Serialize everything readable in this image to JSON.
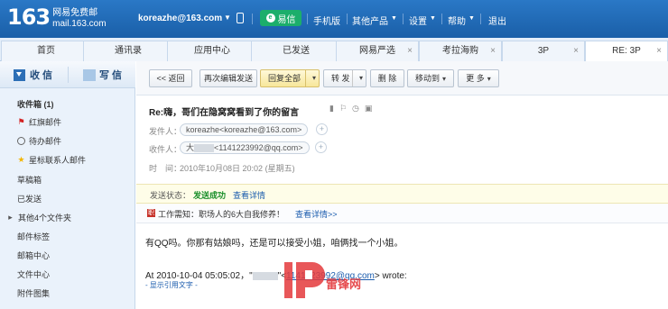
{
  "topbar": {
    "logo_num": "163",
    "logo_cn": "网易免费邮",
    "logo_domain": "mail.163.com",
    "user": "koreazhe@163.com",
    "yixin": "易信",
    "links": [
      "手机版",
      "其他产品",
      "设置",
      "帮助",
      "退出"
    ]
  },
  "tabs": [
    {
      "label": "首页",
      "closable": false
    },
    {
      "label": "通讯录",
      "closable": false
    },
    {
      "label": "应用中心",
      "closable": false
    },
    {
      "label": "已发送",
      "closable": false
    },
    {
      "label": "网易严选",
      "closable": true
    },
    {
      "label": "考拉海购",
      "closable": true
    },
    {
      "label": "3P",
      "closable": true
    },
    {
      "label": "RE: 3P",
      "closable": true
    }
  ],
  "sidebar": {
    "receive": "收 信",
    "compose": "写 信",
    "folders": [
      {
        "label": "收件箱 (1)",
        "icon": "none"
      },
      {
        "label": "红旗邮件",
        "icon": "flag-icon"
      },
      {
        "label": "待办邮件",
        "icon": "clock-icon"
      },
      {
        "label": "星标联系人邮件",
        "icon": "star-icon"
      },
      {
        "label": "草稿箱",
        "icon": "none"
      },
      {
        "label": "已发送",
        "icon": "none"
      },
      {
        "label": "其他4个文件夹",
        "icon": "caret-icon"
      },
      {
        "label": "邮件标签",
        "icon": "none"
      },
      {
        "label": "邮箱中心",
        "icon": "none"
      },
      {
        "label": "文件中心",
        "icon": "none"
      },
      {
        "label": "附件图集",
        "icon": "none"
      }
    ]
  },
  "toolbar": {
    "back": "<< 返回",
    "reedit": "再次编辑发送",
    "reply_all": "回复全部",
    "forward": "转 发",
    "delete": "删 除",
    "move": "移动到",
    "more": "更 多"
  },
  "mail": {
    "subject": "Re:嗨，哥们在隐窝窝看到了你的留言",
    "from_label": "发件人：",
    "from_value": "koreazhe<koreazhe@163.com>",
    "to_label": "收件人：",
    "to_prefix": "大",
    "to_value": "<1141223992@qq.com>",
    "time_label": "时　间：",
    "time_value": "2010年10月08日 20:02 (星期五)",
    "status_label": "发送状态：",
    "status_value": "发送成功",
    "status_link": "查看详情",
    "notice_icon": "职",
    "notice_text": "工作需知：职场人的6大自我修养！",
    "notice_link": "查看详情>>",
    "body": "有QQ吗。你那有姑娘吗，还是可以接受小姐，咱俩找一个小姐。",
    "quote_prefix": "At 2010-10-04 05:05:02，\"",
    "quote_mid": "\"<",
    "quote_email": "1141223992@qq.com",
    "quote_suffix": "> wrote:",
    "show_quote": "- 显示引用文字 -"
  },
  "watermark": {
    "text": "雷锋网"
  }
}
